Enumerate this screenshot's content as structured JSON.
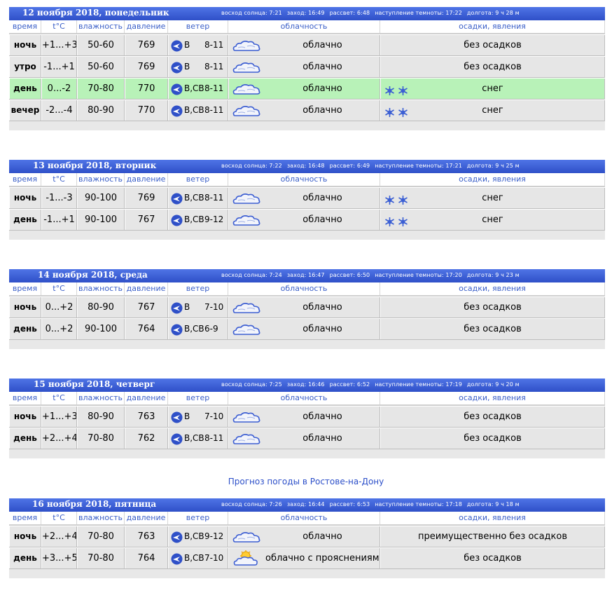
{
  "columns": {
    "time": "время",
    "temp": "t°C",
    "humidity": "влажность",
    "pressure": "давление",
    "wind": "ветер",
    "cloud": "облачность",
    "precip": "осадки, явления"
  },
  "icons": {
    "wind": "wind-direction-icon",
    "cloud": "cloudy-icon",
    "partly": "partly-cloudy-icon",
    "snow": "snowflake-icon"
  },
  "days": [
    {
      "title": "12 ноября 2018, понедельник",
      "sunrise": "восход солнца: 7:21",
      "sunset": "заход: 16:49",
      "dawn": "рассвет: 6:48",
      "dusk": "наступление темноты: 17:22",
      "length": "долгота: 9 ч 28 м",
      "rows": [
        {
          "tod": "ночь",
          "temp": "+1...+3",
          "hum": "50-60",
          "press": "769",
          "wdir": "В",
          "wspd": "8-11",
          "cloud": "облачно",
          "precip": "без осадков"
        },
        {
          "tod": "утро",
          "temp": "-1...+1",
          "hum": "50-60",
          "press": "769",
          "wdir": "В",
          "wspd": "8-11",
          "cloud": "облачно",
          "precip": "без осадков"
        },
        {
          "tod": "день",
          "temp": "0...-2",
          "hum": "70-80",
          "press": "770",
          "wdir": "В,СВ",
          "wspd": "8-11",
          "cloud": "облачно",
          "precip": "снег"
        },
        {
          "tod": "вечер",
          "temp": "-2...-4",
          "hum": "80-90",
          "press": "770",
          "wdir": "В,СВ",
          "wspd": "8-11",
          "cloud": "облачно",
          "precip": "снег"
        }
      ]
    },
    {
      "title": "13 ноября 2018, вторник",
      "sunrise": "восход солнца: 7:22",
      "sunset": "заход: 16:48",
      "dawn": "рассвет: 6:49",
      "dusk": "наступление темноты: 17:21",
      "length": "долгота: 9 ч 25 м",
      "rows": [
        {
          "tod": "ночь",
          "temp": "-1...-3",
          "hum": "90-100",
          "press": "769",
          "wdir": "В,СВ",
          "wspd": "8-11",
          "cloud": "облачно",
          "precip": "снег"
        },
        {
          "tod": "день",
          "temp": "-1...+1",
          "hum": "90-100",
          "press": "767",
          "wdir": "В,СВ",
          "wspd": "9-12",
          "cloud": "облачно",
          "precip": "снег"
        }
      ]
    },
    {
      "title": "14 ноября 2018, среда",
      "sunrise": "восход солнца: 7:24",
      "sunset": "заход: 16:47",
      "dawn": "рассвет: 6:50",
      "dusk": "наступление темноты: 17:20",
      "length": "долгота: 9 ч 23 м",
      "rows": [
        {
          "tod": "ночь",
          "temp": "0...+2",
          "hum": "80-90",
          "press": "767",
          "wdir": "В",
          "wspd": "7-10",
          "cloud": "облачно",
          "precip": "без осадков"
        },
        {
          "tod": "день",
          "temp": "0...+2",
          "hum": "90-100",
          "press": "764",
          "wdir": "В,СВ",
          "wspd": "6-9",
          "cloud": "облачно",
          "precip": "без осадков"
        }
      ]
    },
    {
      "title": "15 ноября 2018, четверг",
      "sunrise": "восход солнца: 7:25",
      "sunset": "заход: 16:46",
      "dawn": "рассвет: 6:52",
      "dusk": "наступление темноты: 17:19",
      "length": "долгота: 9 ч 20 м",
      "rows": [
        {
          "tod": "ночь",
          "temp": "+1...+3",
          "hum": "80-90",
          "press": "763",
          "wdir": "В",
          "wspd": "7-10",
          "cloud": "облачно",
          "precip": "без осадков"
        },
        {
          "tod": "день",
          "temp": "+2...+4",
          "hum": "70-80",
          "press": "762",
          "wdir": "В,СВ",
          "wspd": "8-11",
          "cloud": "облачно",
          "precip": "без осадков"
        }
      ]
    },
    {
      "title": "16 ноября 2018, пятница",
      "sunrise": "восход солнца: 7:26",
      "sunset": "заход: 16:44",
      "dawn": "рассвет: 6:53",
      "dusk": "наступление темноты: 17:18",
      "length": "долгота: 9 ч 18 м",
      "rows": [
        {
          "tod": "ночь",
          "temp": "+2...+4",
          "hum": "70-80",
          "press": "763",
          "wdir": "В,СВ",
          "wspd": "9-12",
          "cloud": "облачно",
          "precip": "преимущественно без осадков"
        },
        {
          "tod": "день",
          "temp": "+3...+5",
          "hum": "70-80",
          "press": "764",
          "wdir": "В,СВ",
          "wspd": "7-10",
          "cloud": "облачно с прояснениями",
          "precip": "без осадков"
        }
      ]
    }
  ],
  "link_text": "Прогноз погоды в Ростове-на-Дону",
  "colors": {
    "header": "#3a5fd8",
    "highlight": "#b8f2b8",
    "row": "#e6e6e6",
    "link": "#2c4fc9"
  }
}
